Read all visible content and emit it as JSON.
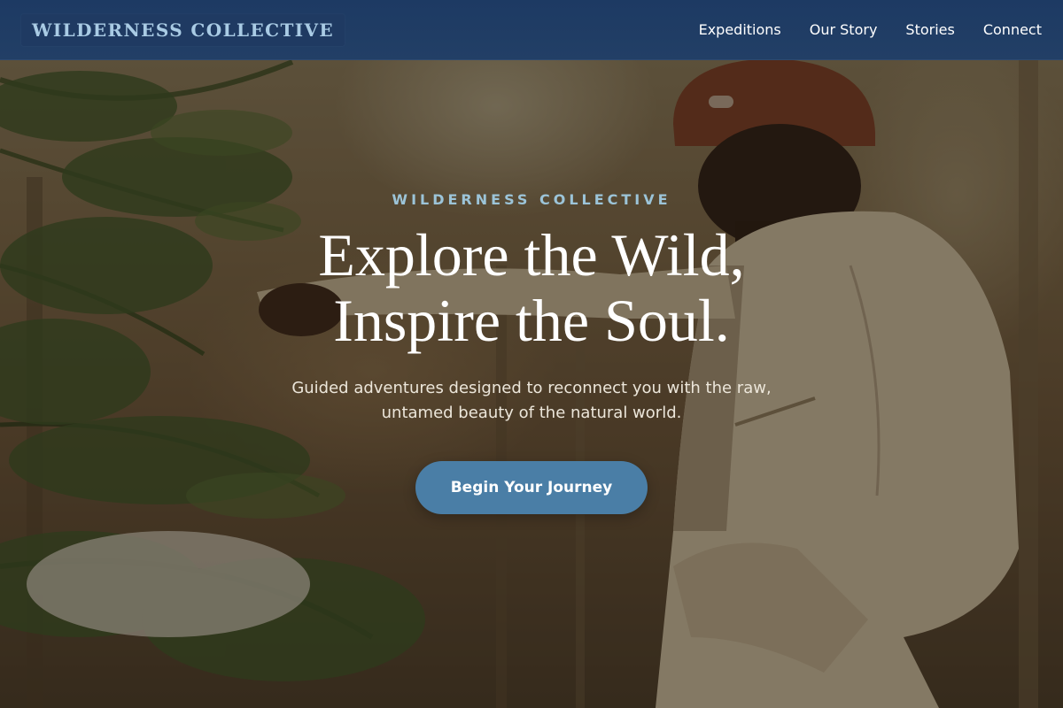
{
  "nav": {
    "brand": "WILDERNESS COLLECTIVE",
    "links": [
      {
        "label": "Expeditions"
      },
      {
        "label": "Our Story"
      },
      {
        "label": "Stories"
      },
      {
        "label": "Connect"
      }
    ]
  },
  "hero": {
    "eyebrow": "WILDERNESS COLLECTIVE",
    "headline_line1": "Explore the Wild,",
    "headline_line2": "Inspire the Soul.",
    "subtitle_line1": "Guided adventures designed to reconnect you with the raw,",
    "subtitle_line2": "untamed beauty of the natural world.",
    "cta_label": "Begin Your Journey",
    "image_subject": "forest-explorer-photo"
  },
  "colors": {
    "nav_background": "#1d3a63",
    "brand_text": "#a9cbe4",
    "eyebrow_text": "#9cc4d8",
    "cta_background": "#4a7ea6",
    "headline_text": "#ffffff"
  }
}
